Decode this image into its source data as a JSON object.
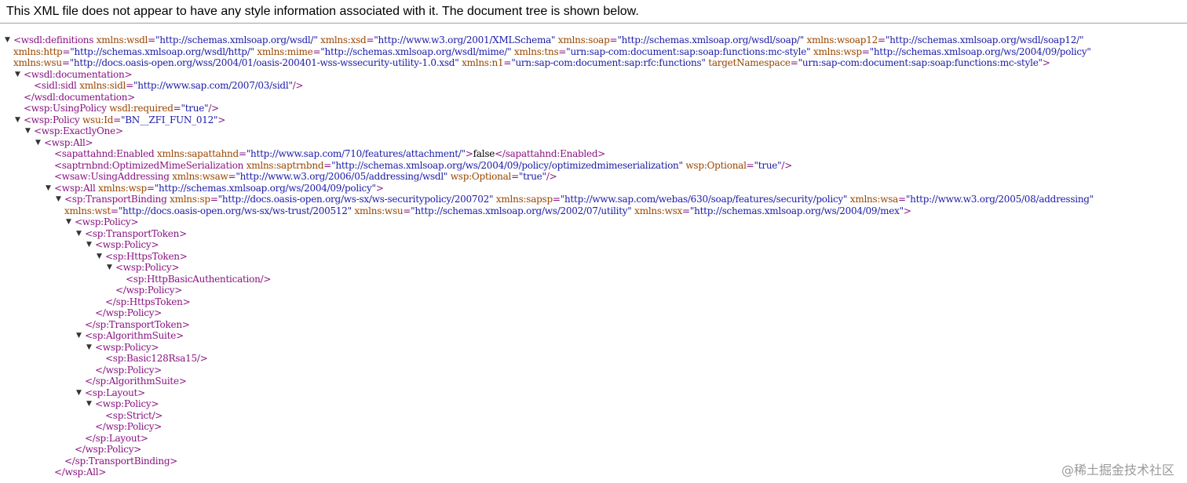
{
  "info_text": "This XML file does not appear to have any style information associated with it. The document tree is shown below.",
  "toggle_glyph": "▼",
  "watermark": "@稀土掘金技术社区",
  "lines": [
    {
      "id": "definitions-open-1",
      "lvl": 0,
      "tog": true,
      "parts": [
        [
          "tag",
          "<wsdl:definitions "
        ],
        [
          "an",
          "xmlns:wsdl"
        ],
        [
          "tag",
          "="
        ],
        [
          "av",
          "\"http://schemas.xmlsoap.org/wsdl/\""
        ],
        [
          "tag",
          " "
        ],
        [
          "an",
          "xmlns:xsd"
        ],
        [
          "tag",
          "="
        ],
        [
          "av",
          "\"http://www.w3.org/2001/XMLSchema\""
        ],
        [
          "tag",
          " "
        ],
        [
          "an",
          "xmlns:soap"
        ],
        [
          "tag",
          "="
        ],
        [
          "av",
          "\"http://schemas.xmlsoap.org/wsdl/soap/\""
        ],
        [
          "tag",
          " "
        ],
        [
          "an",
          "xmlns:wsoap12"
        ],
        [
          "tag",
          "="
        ],
        [
          "av",
          "\"http://schemas.xmlsoap.org/wsdl/soap12/\""
        ]
      ]
    },
    {
      "id": "definitions-open-2",
      "lvl": 0,
      "cont": true,
      "parts": [
        [
          "an",
          "xmlns:http"
        ],
        [
          "tag",
          "="
        ],
        [
          "av",
          "\"http://schemas.xmlsoap.org/wsdl/http/\""
        ],
        [
          "tag",
          " "
        ],
        [
          "an",
          "xmlns:mime"
        ],
        [
          "tag",
          "="
        ],
        [
          "av",
          "\"http://schemas.xmlsoap.org/wsdl/mime/\""
        ],
        [
          "tag",
          " "
        ],
        [
          "an",
          "xmlns:tns"
        ],
        [
          "tag",
          "="
        ],
        [
          "av",
          "\"urn:sap-com:document:sap:soap:functions:mc-style\""
        ],
        [
          "tag",
          " "
        ],
        [
          "an",
          "xmlns:wsp"
        ],
        [
          "tag",
          "="
        ],
        [
          "av",
          "\"http://schemas.xmlsoap.org/ws/2004/09/policy\""
        ]
      ]
    },
    {
      "id": "definitions-open-3",
      "lvl": 0,
      "cont": true,
      "parts": [
        [
          "an",
          "xmlns:wsu"
        ],
        [
          "tag",
          "="
        ],
        [
          "av",
          "\"http://docs.oasis-open.org/wss/2004/01/oasis-200401-wss-wssecurity-utility-1.0.xsd\""
        ],
        [
          "tag",
          " "
        ],
        [
          "an",
          "xmlns:n1"
        ],
        [
          "tag",
          "="
        ],
        [
          "av",
          "\"urn:sap-com:document:sap:rfc:functions\""
        ],
        [
          "tag",
          " "
        ],
        [
          "an",
          "targetNamespace"
        ],
        [
          "tag",
          "="
        ],
        [
          "av",
          "\"urn:sap-com:document:sap:soap:functions:mc-style\""
        ],
        [
          "tag",
          ">"
        ]
      ]
    },
    {
      "id": "documentation-open",
      "lvl": 1,
      "tog": true,
      "parts": [
        [
          "tag",
          "<wsdl:documentation>"
        ]
      ]
    },
    {
      "id": "sidl",
      "lvl": 2,
      "parts": [
        [
          "tag",
          "<sidl:sidl "
        ],
        [
          "an",
          "xmlns:sidl"
        ],
        [
          "tag",
          "="
        ],
        [
          "av",
          "\"http://www.sap.com/2007/03/sidl\""
        ],
        [
          "tag",
          "/>"
        ]
      ]
    },
    {
      "id": "documentation-close",
      "lvl": 1,
      "parts": [
        [
          "tag",
          "</wsdl:documentation>"
        ]
      ]
    },
    {
      "id": "usingpolicy",
      "lvl": 1,
      "parts": [
        [
          "tag",
          "<wsp:UsingPolicy "
        ],
        [
          "an",
          "wsdl:required"
        ],
        [
          "tag",
          "="
        ],
        [
          "av",
          "\"true\""
        ],
        [
          "tag",
          "/>"
        ]
      ]
    },
    {
      "id": "policy-open",
      "lvl": 1,
      "tog": true,
      "parts": [
        [
          "tag",
          "<wsp:Policy "
        ],
        [
          "an",
          "wsu:Id"
        ],
        [
          "tag",
          "="
        ],
        [
          "av",
          "\"BN__ZFI_FUN_012\""
        ],
        [
          "tag",
          ">"
        ]
      ]
    },
    {
      "id": "exactlyone-open",
      "lvl": 2,
      "tog": true,
      "parts": [
        [
          "tag",
          "<wsp:ExactlyOne>"
        ]
      ]
    },
    {
      "id": "all-open",
      "lvl": 3,
      "tog": true,
      "parts": [
        [
          "tag",
          "<wsp:All>"
        ]
      ]
    },
    {
      "id": "sapattahnd",
      "lvl": 4,
      "parts": [
        [
          "tag",
          "<sapattahnd:Enabled "
        ],
        [
          "an",
          "xmlns:sapattahnd"
        ],
        [
          "tag",
          "="
        ],
        [
          "av",
          "\"http://www.sap.com/710/features/attachment/\""
        ],
        [
          "tag",
          ">"
        ],
        [
          "tx",
          "false"
        ],
        [
          "tag",
          "</sapattahnd:Enabled>"
        ]
      ]
    },
    {
      "id": "saptrnbnd",
      "lvl": 4,
      "parts": [
        [
          "tag",
          "<saptrnbnd:OptimizedMimeSerialization "
        ],
        [
          "an",
          "xmlns:saptrnbnd"
        ],
        [
          "tag",
          "="
        ],
        [
          "av",
          "\"http://schemas.xmlsoap.org/ws/2004/09/policy/optimizedmimeserialization\""
        ],
        [
          "tag",
          " "
        ],
        [
          "an",
          "wsp:Optional"
        ],
        [
          "tag",
          "="
        ],
        [
          "av",
          "\"true\""
        ],
        [
          "tag",
          "/>"
        ]
      ]
    },
    {
      "id": "usingaddressing",
      "lvl": 4,
      "parts": [
        [
          "tag",
          "<wsaw:UsingAddressing "
        ],
        [
          "an",
          "xmlns:wsaw"
        ],
        [
          "tag",
          "="
        ],
        [
          "av",
          "\"http://www.w3.org/2006/05/addressing/wsdl\""
        ],
        [
          "tag",
          " "
        ],
        [
          "an",
          "wsp:Optional"
        ],
        [
          "tag",
          "="
        ],
        [
          "av",
          "\"true\""
        ],
        [
          "tag",
          "/>"
        ]
      ]
    },
    {
      "id": "all-inner-open",
      "lvl": 4,
      "tog": true,
      "parts": [
        [
          "tag",
          "<wsp:All "
        ],
        [
          "an",
          "xmlns:wsp"
        ],
        [
          "tag",
          "="
        ],
        [
          "av",
          "\"http://schemas.xmlsoap.org/ws/2004/09/policy\""
        ],
        [
          "tag",
          ">"
        ]
      ]
    },
    {
      "id": "transportbinding-open-1",
      "lvl": 5,
      "tog": true,
      "parts": [
        [
          "tag",
          "<sp:TransportBinding "
        ],
        [
          "an",
          "xmlns:sp"
        ],
        [
          "tag",
          "="
        ],
        [
          "av",
          "\"http://docs.oasis-open.org/ws-sx/ws-securitypolicy/200702\""
        ],
        [
          "tag",
          " "
        ],
        [
          "an",
          "xmlns:sapsp"
        ],
        [
          "tag",
          "="
        ],
        [
          "av",
          "\"http://www.sap.com/webas/630/soap/features/security/policy\""
        ],
        [
          "tag",
          " "
        ],
        [
          "an",
          "xmlns:wsa"
        ],
        [
          "tag",
          "="
        ],
        [
          "av",
          "\"http://www.w3.org/2005/08/addressing\""
        ]
      ]
    },
    {
      "id": "transportbinding-open-2",
      "lvl": 5,
      "cont": true,
      "parts": [
        [
          "an",
          "xmlns:wst"
        ],
        [
          "tag",
          "="
        ],
        [
          "av",
          "\"http://docs.oasis-open.org/ws-sx/ws-trust/200512\""
        ],
        [
          "tag",
          " "
        ],
        [
          "an",
          "xmlns:wsu"
        ],
        [
          "tag",
          "="
        ],
        [
          "av",
          "\"http://schemas.xmlsoap.org/ws/2002/07/utility\""
        ],
        [
          "tag",
          " "
        ],
        [
          "an",
          "xmlns:wsx"
        ],
        [
          "tag",
          "="
        ],
        [
          "av",
          "\"http://schemas.xmlsoap.org/ws/2004/09/mex\""
        ],
        [
          "tag",
          ">"
        ]
      ]
    },
    {
      "id": "tb-policy-open",
      "lvl": 6,
      "tog": true,
      "parts": [
        [
          "tag",
          "<wsp:Policy>"
        ]
      ]
    },
    {
      "id": "transporttoken-open",
      "lvl": 7,
      "tog": true,
      "parts": [
        [
          "tag",
          "<sp:TransportToken>"
        ]
      ]
    },
    {
      "id": "tt-policy-open",
      "lvl": 8,
      "tog": true,
      "parts": [
        [
          "tag",
          "<wsp:Policy>"
        ]
      ]
    },
    {
      "id": "httpstoken-open",
      "lvl": 9,
      "tog": true,
      "parts": [
        [
          "tag",
          "<sp:HttpsToken>"
        ]
      ]
    },
    {
      "id": "ht-policy-open",
      "lvl": 10,
      "tog": true,
      "parts": [
        [
          "tag",
          "<wsp:Policy>"
        ]
      ]
    },
    {
      "id": "basicauth",
      "lvl": 11,
      "parts": [
        [
          "tag",
          "<sp:HttpBasicAuthentication/>"
        ]
      ]
    },
    {
      "id": "ht-policy-close",
      "lvl": 10,
      "parts": [
        [
          "tag",
          "</wsp:Policy>"
        ]
      ]
    },
    {
      "id": "httpstoken-close",
      "lvl": 9,
      "parts": [
        [
          "tag",
          "</sp:HttpsToken>"
        ]
      ]
    },
    {
      "id": "tt-policy-close",
      "lvl": 8,
      "parts": [
        [
          "tag",
          "</wsp:Policy>"
        ]
      ]
    },
    {
      "id": "transporttoken-close",
      "lvl": 7,
      "parts": [
        [
          "tag",
          "</sp:TransportToken>"
        ]
      ]
    },
    {
      "id": "algorithmsuite-open",
      "lvl": 7,
      "tog": true,
      "parts": [
        [
          "tag",
          "<sp:AlgorithmSuite>"
        ]
      ]
    },
    {
      "id": "as-policy-open",
      "lvl": 8,
      "tog": true,
      "parts": [
        [
          "tag",
          "<wsp:Policy>"
        ]
      ]
    },
    {
      "id": "basic128",
      "lvl": 9,
      "parts": [
        [
          "tag",
          "<sp:Basic128Rsa15/>"
        ]
      ]
    },
    {
      "id": "as-policy-close",
      "lvl": 8,
      "parts": [
        [
          "tag",
          "</wsp:Policy>"
        ]
      ]
    },
    {
      "id": "algorithmsuite-close",
      "lvl": 7,
      "parts": [
        [
          "tag",
          "</sp:AlgorithmSuite>"
        ]
      ]
    },
    {
      "id": "layout-open",
      "lvl": 7,
      "tog": true,
      "parts": [
        [
          "tag",
          "<sp:Layout>"
        ]
      ]
    },
    {
      "id": "ly-policy-open",
      "lvl": 8,
      "tog": true,
      "parts": [
        [
          "tag",
          "<wsp:Policy>"
        ]
      ]
    },
    {
      "id": "strict",
      "lvl": 9,
      "parts": [
        [
          "tag",
          "<sp:Strict/>"
        ]
      ]
    },
    {
      "id": "ly-policy-close",
      "lvl": 8,
      "parts": [
        [
          "tag",
          "</wsp:Policy>"
        ]
      ]
    },
    {
      "id": "layout-close",
      "lvl": 7,
      "parts": [
        [
          "tag",
          "</sp:Layout>"
        ]
      ]
    },
    {
      "id": "tb-policy-close",
      "lvl": 6,
      "parts": [
        [
          "tag",
          "</wsp:Policy>"
        ]
      ]
    },
    {
      "id": "transportbinding-close",
      "lvl": 5,
      "parts": [
        [
          "tag",
          "</sp:TransportBinding>"
        ]
      ]
    },
    {
      "id": "all-inner-close",
      "lvl": 4,
      "parts": [
        [
          "tag",
          "</wsp:All>"
        ]
      ]
    }
  ]
}
